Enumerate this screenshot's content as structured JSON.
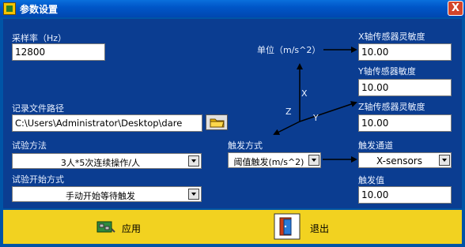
{
  "window": {
    "title": "参数设置",
    "close_label": "X"
  },
  "sampling": {
    "label": "采样率（Hz）",
    "value": "12800"
  },
  "unit_annotation": "单位（m/s^2）",
  "record_path": {
    "label": "记录文件路径",
    "value": "C:\\Users\\Administrator\\Desktop\\dare"
  },
  "test_method": {
    "label": "试验方法",
    "selected": "3人*5次连续操作/人"
  },
  "test_start": {
    "label": "试验开始方式",
    "selected": "手动开始等待触发"
  },
  "trigger_method": {
    "label": "触发方式",
    "selected": "阈值触发(m/s^2)"
  },
  "sensitivity": {
    "x": {
      "label": "X轴传感器灵敏度",
      "value": "10.00"
    },
    "y": {
      "label": "Y轴传感器敏度",
      "value": "10.00"
    },
    "z": {
      "label": "Z轴传感器灵敏度",
      "value": "10.00"
    }
  },
  "trigger_channel": {
    "label": "触发通道",
    "selected": "X-sensors"
  },
  "trigger_value": {
    "label": "触发值",
    "value": "10.00"
  },
  "axes": {
    "x": "X",
    "y": "Y",
    "z": "Z"
  },
  "buttons": {
    "apply": "应用",
    "exit": "退出"
  },
  "colors": {
    "panel": "#0b3d91",
    "bottom_bar": "#f2d220",
    "title_bar": "#0056c8"
  }
}
